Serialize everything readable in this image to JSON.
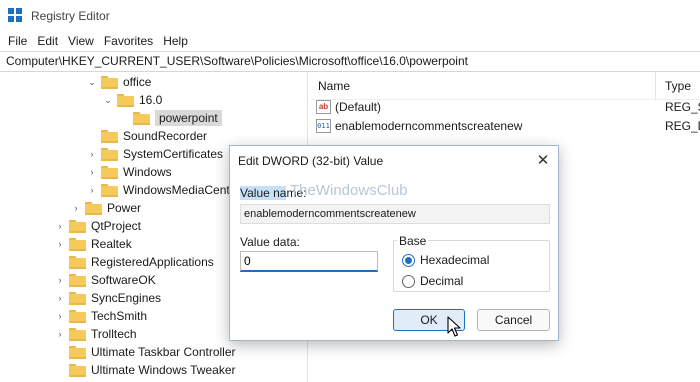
{
  "window": {
    "title": "Registry Editor"
  },
  "menu": [
    "File",
    "Edit",
    "View",
    "Favorites",
    "Help"
  ],
  "address": "Computer\\HKEY_CURRENT_USER\\Software\\Policies\\Microsoft\\office\\16.0\\powerpoint",
  "tree": [
    {
      "label": "office",
      "chevron": "down",
      "expanded": true
    },
    {
      "label": "16.0",
      "chevron": "down",
      "expanded": true
    },
    {
      "label": "powerpoint",
      "chevron": "",
      "selected": true
    },
    {
      "label": "SoundRecorder",
      "chevron": ""
    },
    {
      "label": "SystemCertificates",
      "chevron": "right"
    },
    {
      "label": "Windows",
      "chevron": "right"
    },
    {
      "label": "WindowsMediaCent",
      "chevron": "right"
    },
    {
      "label": "Power",
      "chevron": "right"
    },
    {
      "label": "QtProject",
      "chevron": "right"
    },
    {
      "label": "Realtek",
      "chevron": "right"
    },
    {
      "label": "RegisteredApplications",
      "chevron": ""
    },
    {
      "label": "SoftwareOK",
      "chevron": "right"
    },
    {
      "label": "SyncEngines",
      "chevron": "right"
    },
    {
      "label": "TechSmith",
      "chevron": "right"
    },
    {
      "label": "Trolltech",
      "chevron": "right"
    },
    {
      "label": "Ultimate Taskbar Controller",
      "chevron": ""
    },
    {
      "label": "Ultimate Windows Tweaker",
      "chevron": ""
    }
  ],
  "list": {
    "headers": {
      "name": "Name",
      "type": "Type"
    },
    "rows": [
      {
        "icon": "ab",
        "icon_name": "string-value-icon",
        "name": "(Default)",
        "type": "REG_SZ"
      },
      {
        "icon": "011",
        "icon_name": "dword-value-icon",
        "name": "enablemoderncommentscreatenew",
        "type": "REG_D"
      }
    ]
  },
  "dialog": {
    "title": "Edit DWORD (32-bit) Value",
    "close_glyph": "✕",
    "value_name_label_hl": "Value na",
    "value_name_label_rest": "me:",
    "watermark": "TheWindowsClub",
    "value_name": "enablemoderncommentscreatenew",
    "value_data_label": "Value data:",
    "value_data": "0",
    "base_label": "Base",
    "options": [
      "Hexadecimal",
      "Decimal"
    ],
    "selected_option": "Hexadecimal",
    "ok_label": "OK",
    "cancel_label": "Cancel"
  },
  "colors": {
    "accent": "#1e6fc4",
    "folder": "#f5c95a",
    "selection": "#d9d9d9"
  }
}
